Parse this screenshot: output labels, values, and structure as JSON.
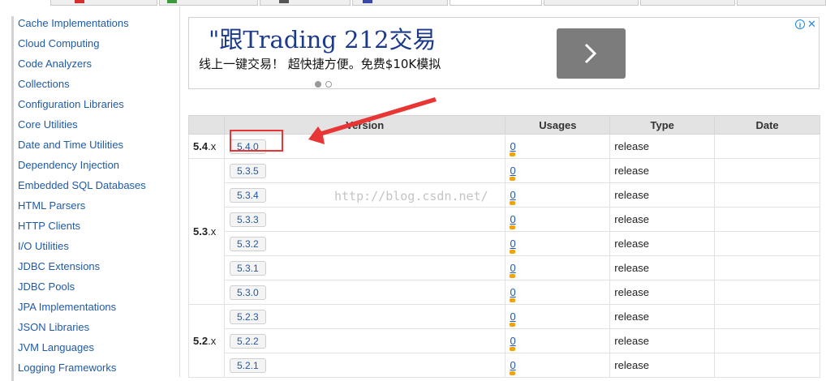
{
  "sidebar": {
    "items": [
      "Cache Implementations",
      "Cloud Computing",
      "Code Analyzers",
      "Collections",
      "Configuration Libraries",
      "Core Utilities",
      "Date and Time Utilities",
      "Dependency Injection",
      "Embedded SQL Databases",
      "HTML Parsers",
      "HTTP Clients",
      "I/O Utilities",
      "JDBC Extensions",
      "JDBC Pools",
      "JPA Implementations",
      "JSON Libraries",
      "JVM Languages",
      "Logging Frameworks"
    ]
  },
  "ad": {
    "title": "\"跟Trading 212交易",
    "subtitle": "线上一键交易！ 超快捷方便。免费$10K模拟",
    "next_icon": "chevron-right-icon",
    "info_icon": "info-icon",
    "close_icon": "close-icon"
  },
  "table": {
    "headers": [
      "",
      "Version",
      "Usages",
      "Type",
      "Date"
    ],
    "groups": [
      {
        "major": "5.4",
        "suffix": ".x",
        "rows": [
          {
            "version": "5.4.0",
            "usages": "0",
            "type": "release",
            "date": ""
          }
        ]
      },
      {
        "major": "5.3",
        "suffix": ".x",
        "rows": [
          {
            "version": "5.3.5",
            "usages": "0",
            "type": "release",
            "date": ""
          },
          {
            "version": "5.3.4",
            "usages": "0",
            "type": "release",
            "date": ""
          },
          {
            "version": "5.3.3",
            "usages": "0",
            "type": "release",
            "date": ""
          },
          {
            "version": "5.3.2",
            "usages": "0",
            "type": "release",
            "date": ""
          },
          {
            "version": "5.3.1",
            "usages": "0",
            "type": "release",
            "date": ""
          },
          {
            "version": "5.3.0",
            "usages": "0",
            "type": "release",
            "date": ""
          }
        ]
      },
      {
        "major": "5.2",
        "suffix": ".x",
        "rows": [
          {
            "version": "5.2.3",
            "usages": "0",
            "type": "release",
            "date": ""
          },
          {
            "version": "5.2.2",
            "usages": "0",
            "type": "release",
            "date": ""
          },
          {
            "version": "5.2.1",
            "usages": "0",
            "type": "release",
            "date": ""
          }
        ]
      }
    ]
  },
  "watermark": "http://blog.csdn.net/",
  "colors": {
    "link": "#1f5aa7",
    "highlight": "#e83535",
    "usage_bar": "#f0a30a",
    "header_bg": "#e3e3e3"
  }
}
